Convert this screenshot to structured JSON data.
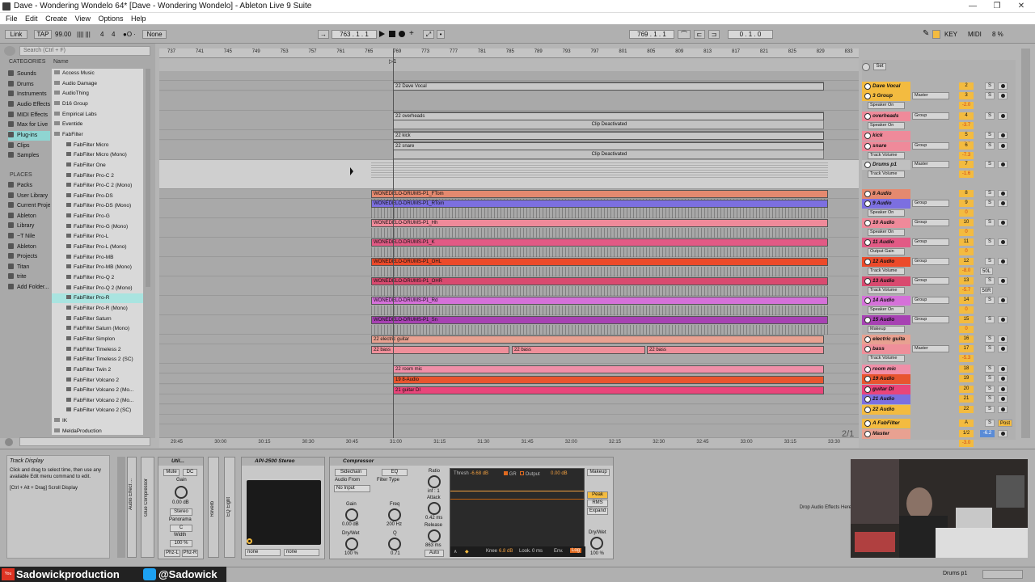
{
  "window": {
    "title": "Dave - Wondering Wondelo 64*  [Dave - Wondering Wondelo] - Ableton Live 9 Suite",
    "controls": [
      "—",
      "❐",
      "✕"
    ]
  },
  "menu": [
    "File",
    "Edit",
    "Create",
    "View",
    "Options",
    "Help"
  ],
  "control_bar": {
    "link": "Link",
    "tap": "TAP",
    "tempo": "99.00",
    "meter_dots": "|||| |||",
    "sig_num": "4",
    "sig_den": "4",
    "metro": "●O ·",
    "quant": "None",
    "pos": [
      "763",
      ".",
      "1",
      ".",
      "1"
    ],
    "loop_start": [
      "769",
      ".",
      "1",
      ".",
      "1"
    ],
    "loop_len": [
      "0",
      ".",
      "1",
      ".",
      "0"
    ],
    "key": "KEY",
    "midi": "MIDI",
    "cpu": "8 %",
    "draw": "✎"
  },
  "browser": {
    "search_placeholder": "Search (Ctrl + F)",
    "categories_header": "CATEGORIES",
    "categories": [
      "Sounds",
      "Drums",
      "Instruments",
      "Audio Effects",
      "MIDI Effects",
      "Max for Live",
      "Plug-ins",
      "Clips",
      "Samples"
    ],
    "places_header": "PLACES",
    "places": [
      "Packs",
      "User Library",
      "Current Project",
      "Ableton",
      "Library",
      "~T Nile",
      "Ableton",
      "Projects",
      "Titan",
      "trite",
      "Add Folder..."
    ],
    "name_header": "Name",
    "items": [
      "Access Music",
      "Audio Damage",
      "AudioThing",
      "D16 Group",
      "Empirical Labs",
      "Eventide",
      "FabFilter",
      "FabFilter Micro",
      "FabFilter Micro (Mono)",
      "FabFilter One",
      "FabFilter Pro-C 2",
      "FabFilter Pro-C 2 (Mono)",
      "FabFilter Pro-DS",
      "FabFilter Pro-DS (Mono)",
      "FabFilter Pro-G",
      "FabFilter Pro-G (Mono)",
      "FabFilter Pro-L",
      "FabFilter Pro-L (Mono)",
      "FabFilter Pro-MB",
      "FabFilter Pro-MB (Mono)",
      "FabFilter Pro-Q 2",
      "FabFilter Pro-Q 2 (Mono)",
      "FabFilter Pro-R",
      "FabFilter Pro-R (Mono)",
      "FabFilter Saturn",
      "FabFilter Saturn (Mono)",
      "FabFilter Simplon",
      "FabFilter Timeless 2",
      "FabFilter Timeless 2 (SC)",
      "FabFilter Twin 2",
      "FabFilter Volcano 2",
      "FabFilter Volcano 2 (Mo...",
      "FabFilter Volcano 2 (Mo...",
      "FabFilter Volcano 2 (SC)",
      "IK",
      "MeldaProduction"
    ]
  },
  "ruler": [
    "737",
    "741",
    "745",
    "749",
    "753",
    "757",
    "761",
    "765",
    "769",
    "773",
    "777",
    "781",
    "785",
    "789",
    "793",
    "797",
    "801",
    "805",
    "809",
    "813",
    "817",
    "821",
    "825",
    "829",
    "833"
  ],
  "time_ruler": [
    "29:45",
    "30:00",
    "30:15",
    "30:30",
    "30:45",
    "31:00",
    "31:15",
    "31:30",
    "31:45",
    "32:00",
    "32:15",
    "32:30",
    "32:45",
    "33:00",
    "33:15",
    "33:30"
  ],
  "arr_marker": "▷1",
  "page": "2/1",
  "clips": [
    {
      "label": "22 Dave Vocal"
    },
    {
      "label": "22 overheads"
    },
    {
      "label": "Clip Deactivated"
    },
    {
      "label": "22 kick"
    },
    {
      "label": "22 snare"
    },
    {
      "label": "Clip Deactivated"
    },
    {
      "label": "WONEDELO-DRUMS-P1_FTom"
    },
    {
      "label": "WONEDELO-DRUMS-P1_RTom"
    },
    {
      "label": "WONEDELO-DRUMS-P1_Hh"
    },
    {
      "label": "WONEDELO-DRUMS-P1_K"
    },
    {
      "label": "WONEDELO-DRUMS-P1_OHL"
    },
    {
      "label": "WONEDELO-DRUMS-P1_OHR"
    },
    {
      "label": "WONEDELO-DRUMS-P1_Rd"
    },
    {
      "label": "WONEDELO-DRUMS-P1_Sn"
    },
    {
      "label": "22 electric guitar"
    },
    {
      "label": "22 bass"
    },
    {
      "label": "22 bass"
    },
    {
      "label": "22 bass"
    },
    {
      "label": "22 room mic"
    },
    {
      "label": "19 8-Audio"
    },
    {
      "label": "21 guitar DI"
    }
  ],
  "mixer": {
    "set_label": "Set",
    "tracks": [
      {
        "name": "Dave Vocal",
        "num": "2",
        "vol": "",
        "route": ""
      },
      {
        "name": "3 Group",
        "num": "3",
        "vol": "-2.0",
        "route": "Master",
        "sub": "Speaker On"
      },
      {
        "name": "overheads",
        "num": "4",
        "vol": "-3.7",
        "route": "Group",
        "sub": "Speaker On"
      },
      {
        "name": "kick",
        "num": "5",
        "vol": "-8.0",
        "route": "",
        "sub": ""
      },
      {
        "name": "snare",
        "num": "6",
        "vol": "-7.3",
        "route": "Group",
        "sub": "Track Volume"
      },
      {
        "name": "Drums p1",
        "num": "7",
        "vol": "-1.6",
        "route": "Master",
        "sub": "Track Volume"
      },
      {
        "name": "8 Audio",
        "num": "8",
        "vol": "-inf",
        "route": "",
        "sub": ""
      },
      {
        "name": "9 Audio",
        "num": "9",
        "vol": "0",
        "route": "Group",
        "sub": "Speaker On"
      },
      {
        "name": "10 Audio",
        "num": "10",
        "vol": "0",
        "route": "Group",
        "sub": "Speaker On"
      },
      {
        "name": "11 Audio",
        "num": "11",
        "vol": "0",
        "route": "Group",
        "sub": "Output Gain"
      },
      {
        "name": "12 Audio",
        "num": "12",
        "vol": "-8.0",
        "route": "Group",
        "sub": "Track Volume",
        "pan": "50L"
      },
      {
        "name": "13 Audio",
        "num": "13",
        "vol": "-5.7",
        "route": "Group",
        "sub": "Track Volume",
        "pan": "50R"
      },
      {
        "name": "14 Audio",
        "num": "14",
        "vol": "0",
        "route": "Group",
        "sub": "Speaker On"
      },
      {
        "name": "15 Audio",
        "num": "15",
        "vol": "0",
        "route": "Group",
        "sub": "Makeup"
      },
      {
        "name": "electric guita",
        "num": "16",
        "vol": "",
        "route": "",
        "sub": ""
      },
      {
        "name": "bass",
        "num": "17",
        "vol": "-5.3",
        "route": "Master",
        "sub": "Track Volume"
      },
      {
        "name": "room mic",
        "num": "18",
        "vol": "",
        "route": "",
        "sub": ""
      },
      {
        "name": "19 Audio",
        "num": "19",
        "vol": "",
        "route": "",
        "sub": ""
      },
      {
        "name": "guitar DI",
        "num": "20",
        "vol": "",
        "route": "",
        "sub": ""
      },
      {
        "name": "21 Audio",
        "num": "21",
        "vol": "",
        "route": "",
        "sub": ""
      },
      {
        "name": "22 Audio",
        "num": "22",
        "vol": "",
        "route": "",
        "sub": ""
      },
      {
        "name": "A FabFilter",
        "num": "A",
        "vol": "",
        "route": "",
        "post": "Post"
      },
      {
        "name": "Master",
        "num": "1/2",
        "vol": "-3.0",
        "route": "",
        "master_vol": "-6.2"
      }
    ]
  },
  "info": {
    "title": "Track Display",
    "text1": "Click and drag to select time, then use any available Edit menu command to edit.",
    "text2": "[Ctrl + Alt + Drag] Scroll Display"
  },
  "devices": {
    "rack_labels": [
      "Audio Effect ...",
      "Glue Compressor",
      "Reverb",
      "EQ Eight"
    ],
    "util": {
      "title": "Util...",
      "mute": "Mute",
      "dc": "DC",
      "gain": "Gain",
      "gain_val": "0.00 dB",
      "mode": "Stereo",
      "pan_lbl": "Panorama",
      "pan_val": "C",
      "width_lbl": "Width",
      "width_val": "100 %",
      "phz_l": "Phz-L",
      "phz_r": "Phz-R"
    },
    "api": {
      "title": "API-2500 Stereo",
      "none1": "none",
      "none2": "none"
    },
    "comp": {
      "title": "Compressor",
      "sidechain": "Sidechain",
      "eq": "EQ",
      "audio_from": "Audio From",
      "no_input": "No Input",
      "filter_type": "Filter Type",
      "gain": "Gain",
      "gain_val": "0.00 dB",
      "drywet": "Dry/Wet",
      "drywet_val": "100 %",
      "freq": "Freq",
      "freq_val": "200 Hz",
      "q": "Q",
      "q_val": "0.71",
      "ratio": "Ratio",
      "ratio_val": "inf : 1",
      "attack": "Attack",
      "attack_val": "0.42 ms",
      "release": "Release",
      "release_val": "863 ms",
      "auto": "Auto",
      "thresh": "Thresh",
      "thresh_val": "-6.68 dB",
      "gr": "GR",
      "output": "Output",
      "out_val": "0.00 dB",
      "makeup": "Makeup",
      "peak": "Peak",
      "rms": "RMS",
      "expand": "Expand",
      "knee": "Knee",
      "knee_val": "6.8 dB",
      "look": "Look.",
      "look_val": "0 ms",
      "env": "Env.",
      "log": "Log",
      "dw": "Dry/Wet",
      "dw_val": "100 %"
    },
    "drop": "Drop Audio Effects Here"
  },
  "social": {
    "yt": "You Tube",
    "yt_name": "Sadowickproduction",
    "tw_name": "@Sadowick"
  },
  "status": {
    "right": "Drums p1"
  }
}
